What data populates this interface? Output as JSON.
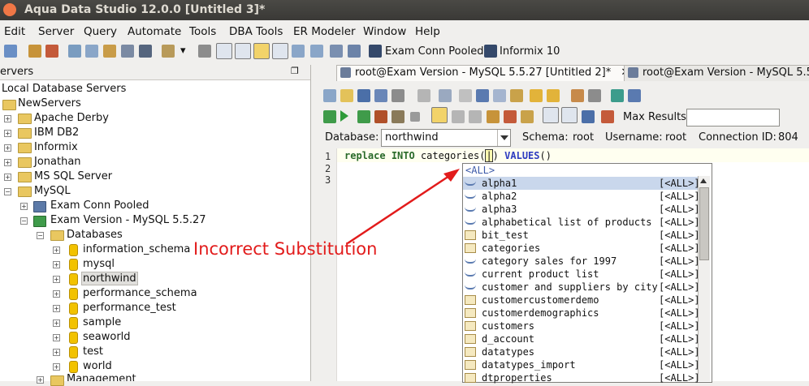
{
  "window": {
    "title": "Aqua Data Studio 12.0.0 [Untitled 3]*"
  },
  "menu": [
    "Edit",
    "Server",
    "Query",
    "Automate",
    "Tools",
    "DBA Tools",
    "ER Modeler",
    "Window",
    "Help"
  ],
  "toolbar": {
    "exam_conn_pooled": "Exam Conn Pooled",
    "informix10": "Informix 10"
  },
  "left_panel": {
    "header": "ervers",
    "tree": {
      "root": "Local Database Servers",
      "group": "NewServers",
      "servers": [
        "Apache Derby",
        "IBM DB2",
        "Informix",
        "Jonathan",
        "MS SQL Server",
        "MySQL"
      ],
      "mysql_children": [
        "Exam Conn Pooled",
        "Exam Version - MySQL 5.5.27"
      ],
      "databases_label": "Databases",
      "databases": [
        "information_schema",
        "mysql",
        "northwind",
        "performance_schema",
        "performance_test",
        "sample",
        "seaworld",
        "test",
        "world"
      ],
      "next_item": "Management"
    }
  },
  "tabs": [
    {
      "label": "root@Exam Version - MySQL 5.5.27 [Untitled 2]*",
      "close": "✕"
    },
    {
      "label": "root@Exam Version - MySQL 5.5.2"
    }
  ],
  "query_toolbar": {
    "max_results_label": "Max Results:",
    "database_label": "Database:",
    "database_value": "northwind",
    "schema_label": "Schema:",
    "schema_value": "root",
    "username_label": "Username:",
    "username_value": "root",
    "connection_label": "Connection ID:",
    "connection_value": "804"
  },
  "editor": {
    "line_numbers": [
      "1",
      "2",
      "3"
    ],
    "line1": {
      "kw1": "replace",
      "kw2": "INTO",
      "text1": "categories(",
      "cursor": "|",
      "text2": ")",
      "kw3": "VALUES",
      "text3": "()"
    }
  },
  "autocomplete": {
    "header": "<ALL>",
    "items": [
      {
        "name": "alpha1",
        "schema": "[<ALL>]",
        "type": "view"
      },
      {
        "name": "alpha2",
        "schema": "[<ALL>]",
        "type": "view"
      },
      {
        "name": "alpha3",
        "schema": "[<ALL>]",
        "type": "view"
      },
      {
        "name": "alphabetical list of products",
        "schema": "[<ALL>]",
        "type": "view"
      },
      {
        "name": "bit_test",
        "schema": "[<ALL>]",
        "type": "table"
      },
      {
        "name": "categories",
        "schema": "[<ALL>]",
        "type": "table"
      },
      {
        "name": "category sales for 1997",
        "schema": "[<ALL>]",
        "type": "view"
      },
      {
        "name": "current product list",
        "schema": "[<ALL>]",
        "type": "view"
      },
      {
        "name": "customer and suppliers by city",
        "schema": "[<ALL>]",
        "type": "view"
      },
      {
        "name": "customercustomerdemo",
        "schema": "[<ALL>]",
        "type": "table"
      },
      {
        "name": "customerdemographics",
        "schema": "[<ALL>]",
        "type": "table"
      },
      {
        "name": "customers",
        "schema": "[<ALL>]",
        "type": "table"
      },
      {
        "name": "d_account",
        "schema": "[<ALL>]",
        "type": "table"
      },
      {
        "name": "datatypes",
        "schema": "[<ALL>]",
        "type": "table"
      },
      {
        "name": "datatypes_import",
        "schema": "[<ALL>]",
        "type": "table"
      },
      {
        "name": "dtproperties",
        "schema": "[<ALL>]",
        "type": "table"
      }
    ]
  },
  "annotation": {
    "text": "Incorrect Substitution",
    "color": "#e21b1b"
  },
  "colors": {
    "selection": "#c9d7ec",
    "annotation": "#e21b1b",
    "keyword": "#2a6a2a"
  }
}
